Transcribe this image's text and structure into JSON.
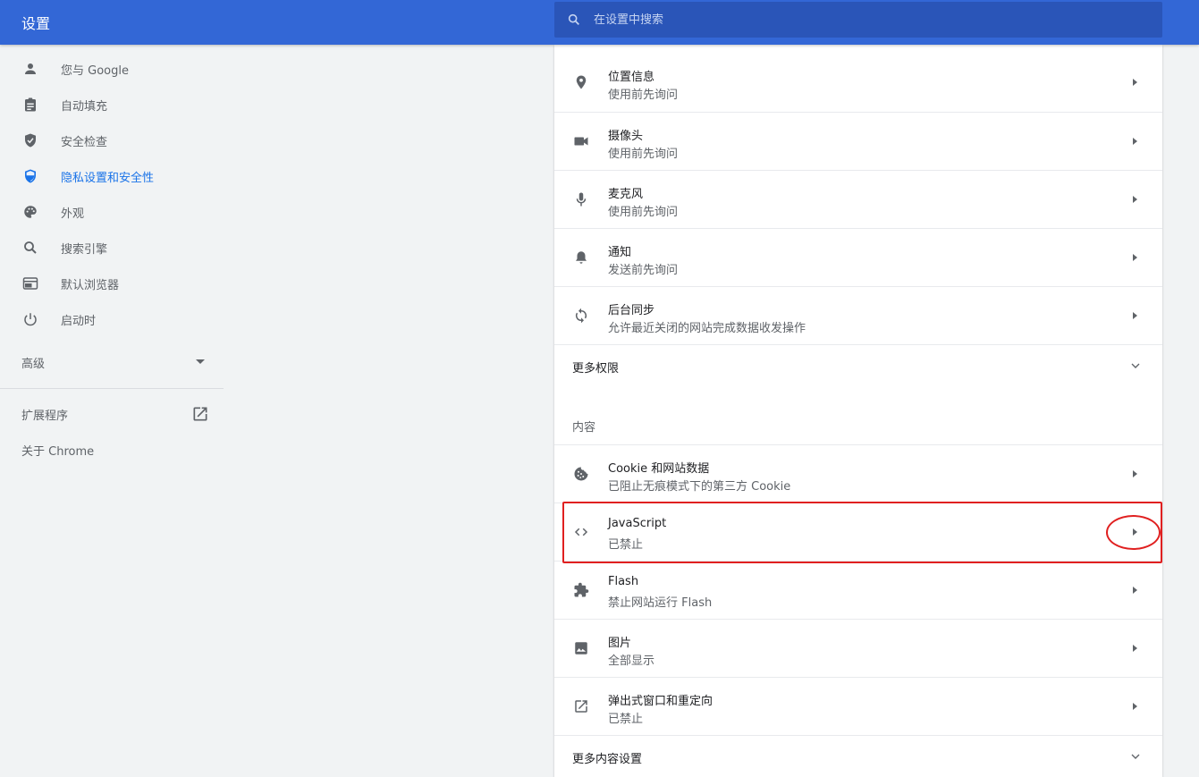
{
  "header": {
    "title": "设置",
    "search_placeholder": "在设置中搜索"
  },
  "sidebar": {
    "items": [
      {
        "label": "您与 Google",
        "icon": "person-icon",
        "active": false
      },
      {
        "label": "自动填充",
        "icon": "clipboard-icon",
        "active": false
      },
      {
        "label": "安全检查",
        "icon": "shield-check-icon",
        "active": false
      },
      {
        "label": "隐私设置和安全性",
        "icon": "shield-icon",
        "active": true
      },
      {
        "label": "外观",
        "icon": "palette-icon",
        "active": false
      },
      {
        "label": "搜索引擎",
        "icon": "search-icon",
        "active": false
      },
      {
        "label": "默认浏览器",
        "icon": "browser-icon",
        "active": false
      },
      {
        "label": "启动时",
        "icon": "power-icon",
        "active": false
      }
    ],
    "advanced_label": "高级",
    "extensions_label": "扩展程序",
    "about_label": "关于 Chrome"
  },
  "permissions": [
    {
      "title": "位置信息",
      "subtitle": "使用前先询问",
      "icon": "location-pin-icon"
    },
    {
      "title": "摄像头",
      "subtitle": "使用前先询问",
      "icon": "camera-icon"
    },
    {
      "title": "麦克风",
      "subtitle": "使用前先询问",
      "icon": "microphone-icon"
    },
    {
      "title": "通知",
      "subtitle": "发送前先询问",
      "icon": "bell-icon"
    },
    {
      "title": "后台同步",
      "subtitle": "允许最近关闭的网站完成数据收发操作",
      "icon": "sync-icon"
    }
  ],
  "more_permissions_label": "更多权限",
  "content_section_label": "内容",
  "content": [
    {
      "title": "Cookie 和网站数据",
      "subtitle": "已阻止无痕模式下的第三方 Cookie",
      "icon": "cookie-icon"
    },
    {
      "title": "JavaScript",
      "subtitle": "已禁止",
      "icon": "code-icon"
    },
    {
      "title": "Flash",
      "subtitle": "禁止网站运行 Flash",
      "icon": "puzzle-icon"
    },
    {
      "title": "图片",
      "subtitle": "全部显示",
      "icon": "image-icon"
    },
    {
      "title": "弹出式窗口和重定向",
      "subtitle": "已禁止",
      "icon": "open-in-new-icon"
    }
  ],
  "more_content_label": "更多内容设置",
  "colors": {
    "header_blue": "#3367d6",
    "active_blue": "#1a73e8",
    "annotation_red": "#e02020"
  }
}
